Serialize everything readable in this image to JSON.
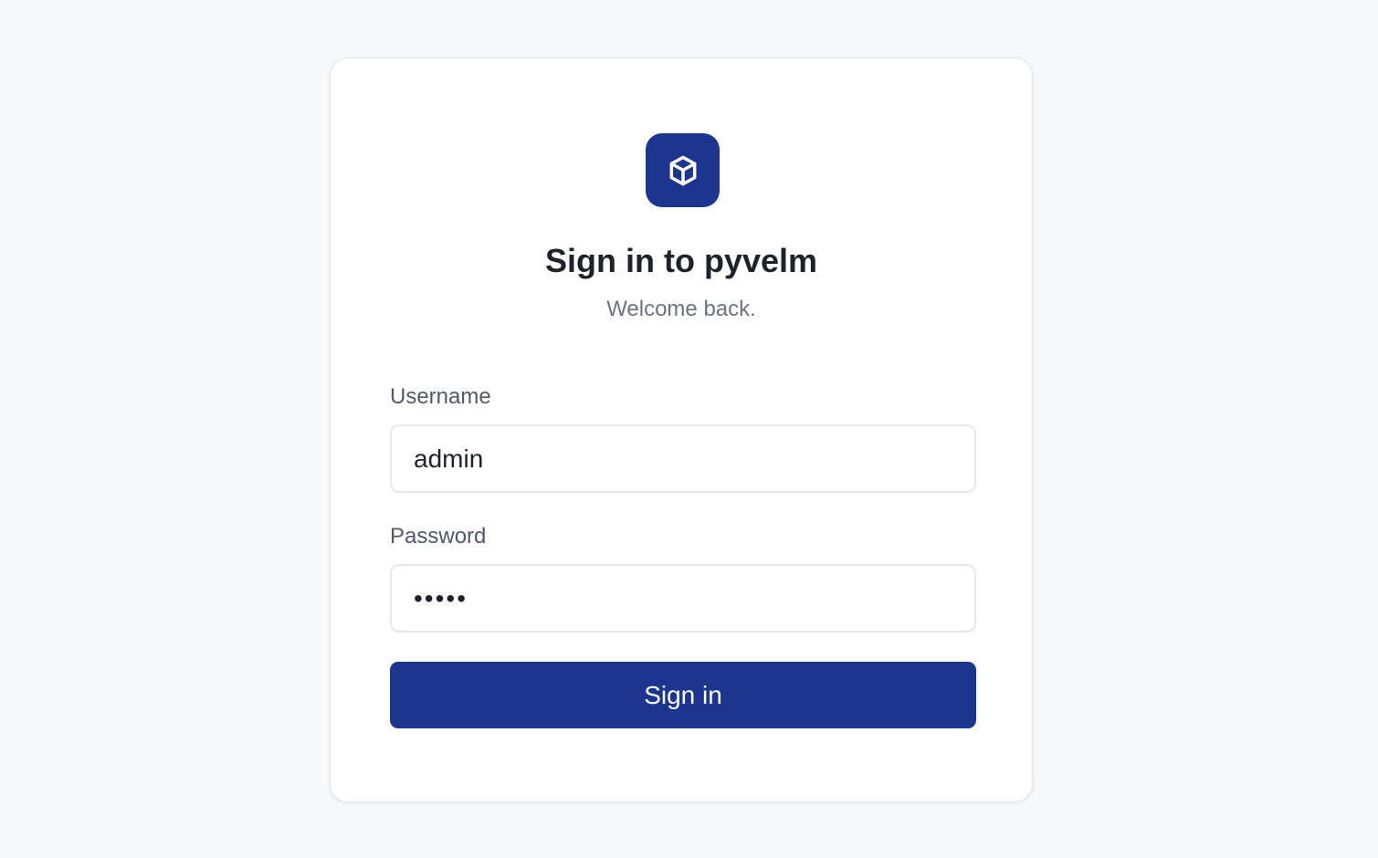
{
  "app": {
    "icon": "cube-icon",
    "title": "Sign in to pyvelm",
    "subtitle": "Welcome back."
  },
  "form": {
    "username_label": "Username",
    "username_value": "admin",
    "password_label": "Password",
    "password_value": "•••••",
    "submit_label": "Sign in"
  },
  "colors": {
    "accent": "#1c358e",
    "background": "#f7f8fa",
    "card": "#ffffff"
  }
}
